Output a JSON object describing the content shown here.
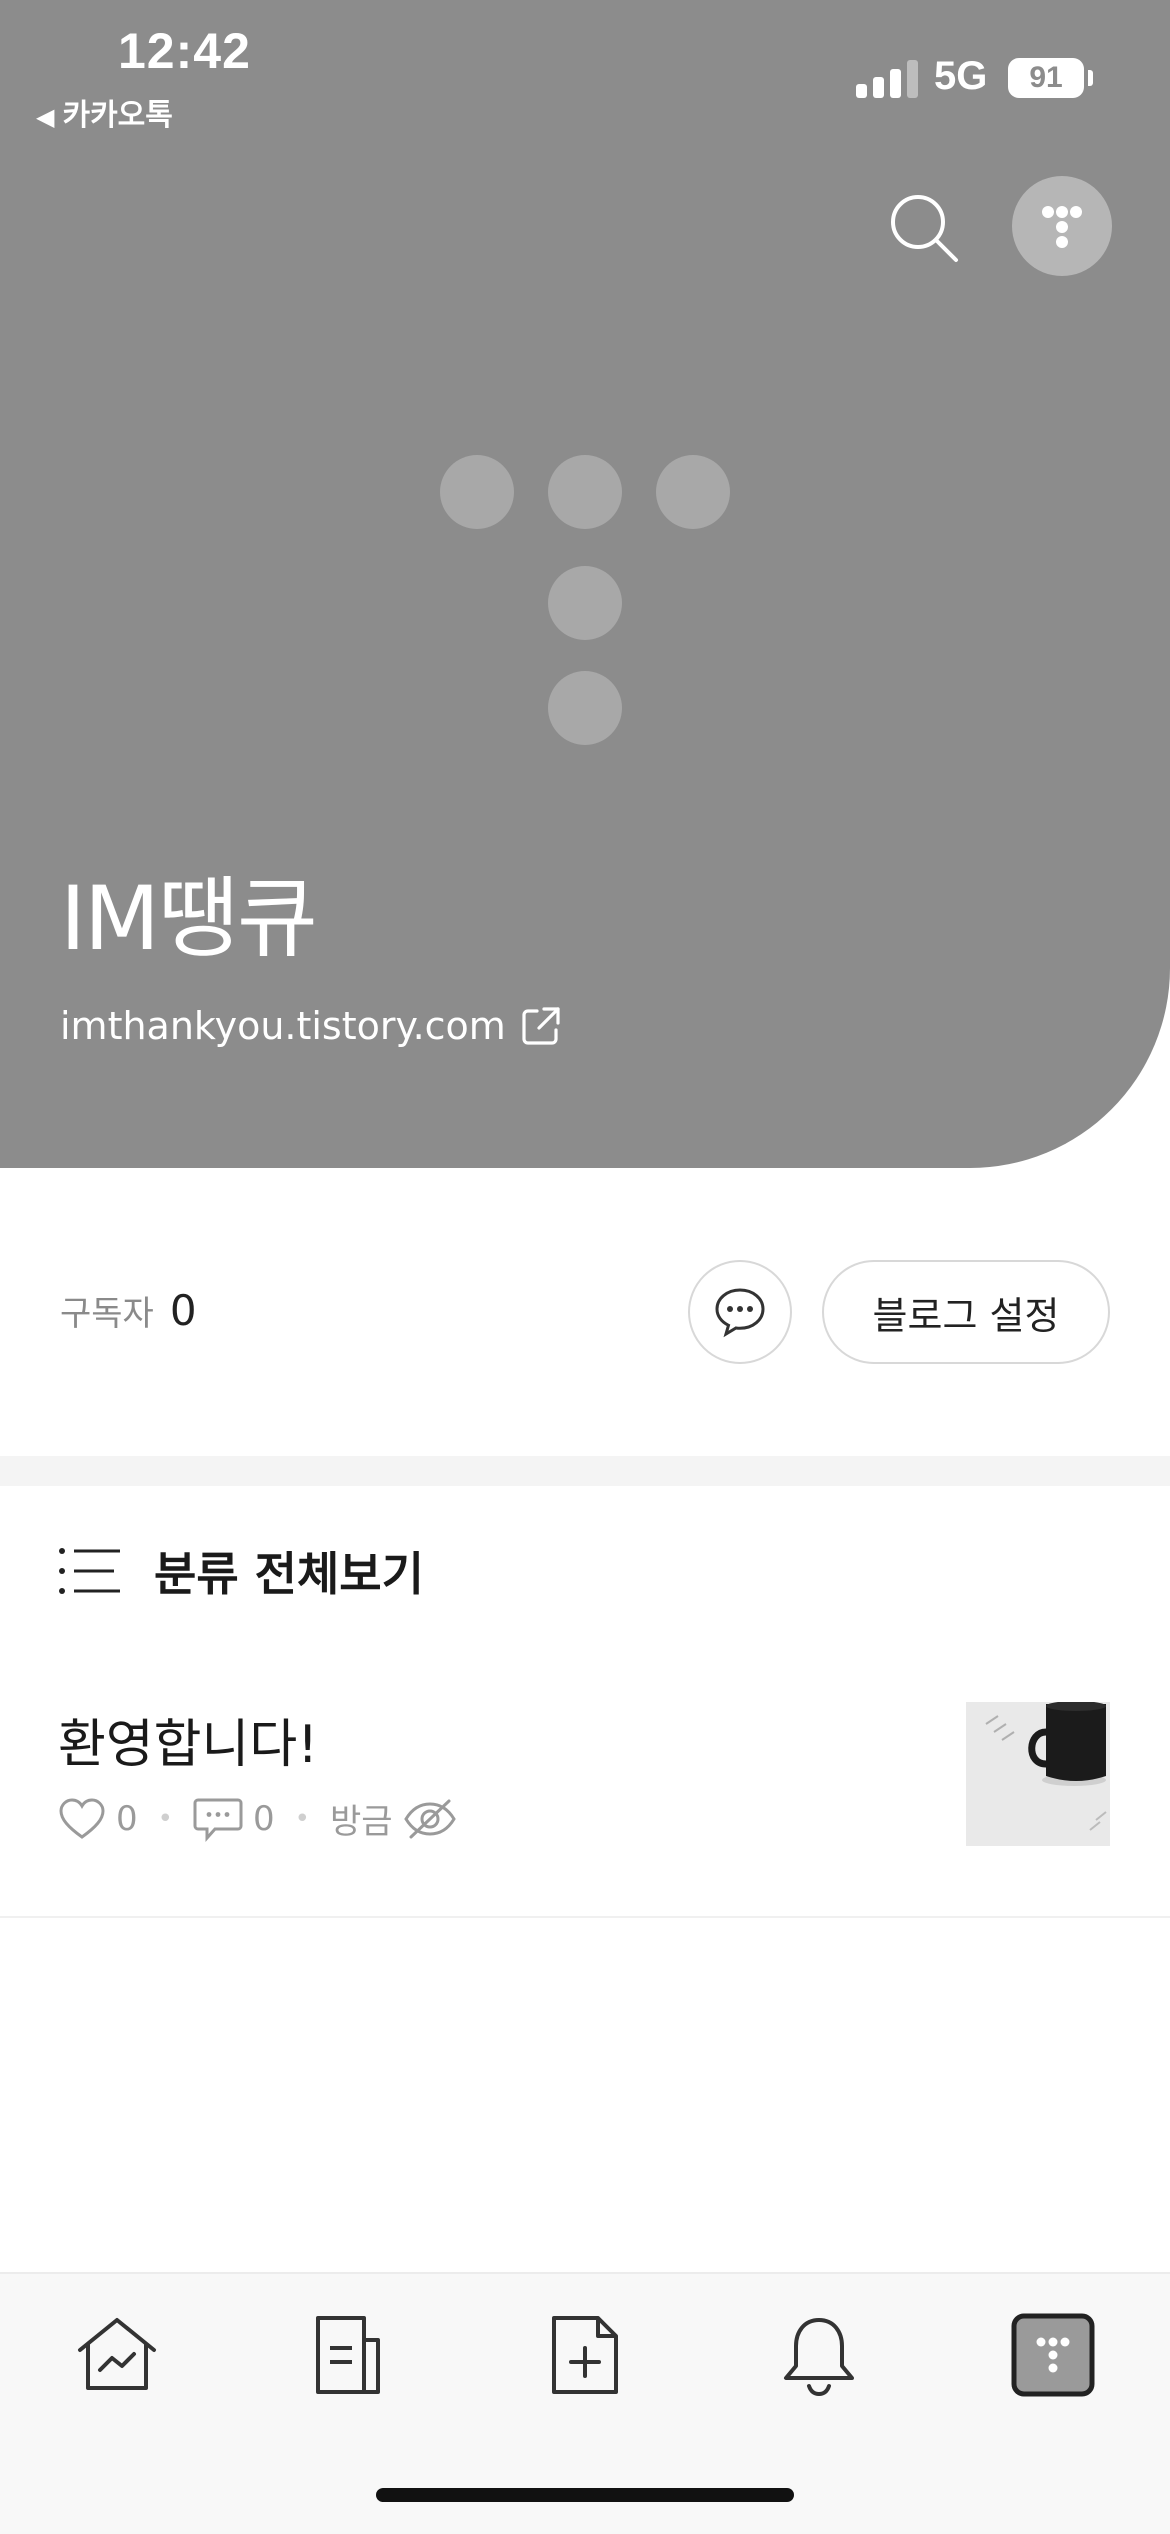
{
  "status_bar": {
    "time": "12:42",
    "back_label": "카카오톡",
    "network": "5G",
    "battery": "91"
  },
  "header": {
    "search_icon": "search-icon",
    "avatar_icon": "tistory-logo-icon"
  },
  "blog": {
    "title": "IM땡큐",
    "url": "imthankyou.tistory.com"
  },
  "stats": {
    "subscribers_label": "구독자",
    "subscribers_count": "0"
  },
  "actions": {
    "settings_label": "블로그 설정"
  },
  "category": {
    "label": "분류 전체보기"
  },
  "posts": [
    {
      "title": "환영합니다!",
      "likes": "0",
      "comments": "0",
      "time": "방금"
    }
  ],
  "tabs": [
    "home-icon",
    "posts-icon",
    "new-post-icon",
    "notifications-icon",
    "my-blog-icon"
  ]
}
